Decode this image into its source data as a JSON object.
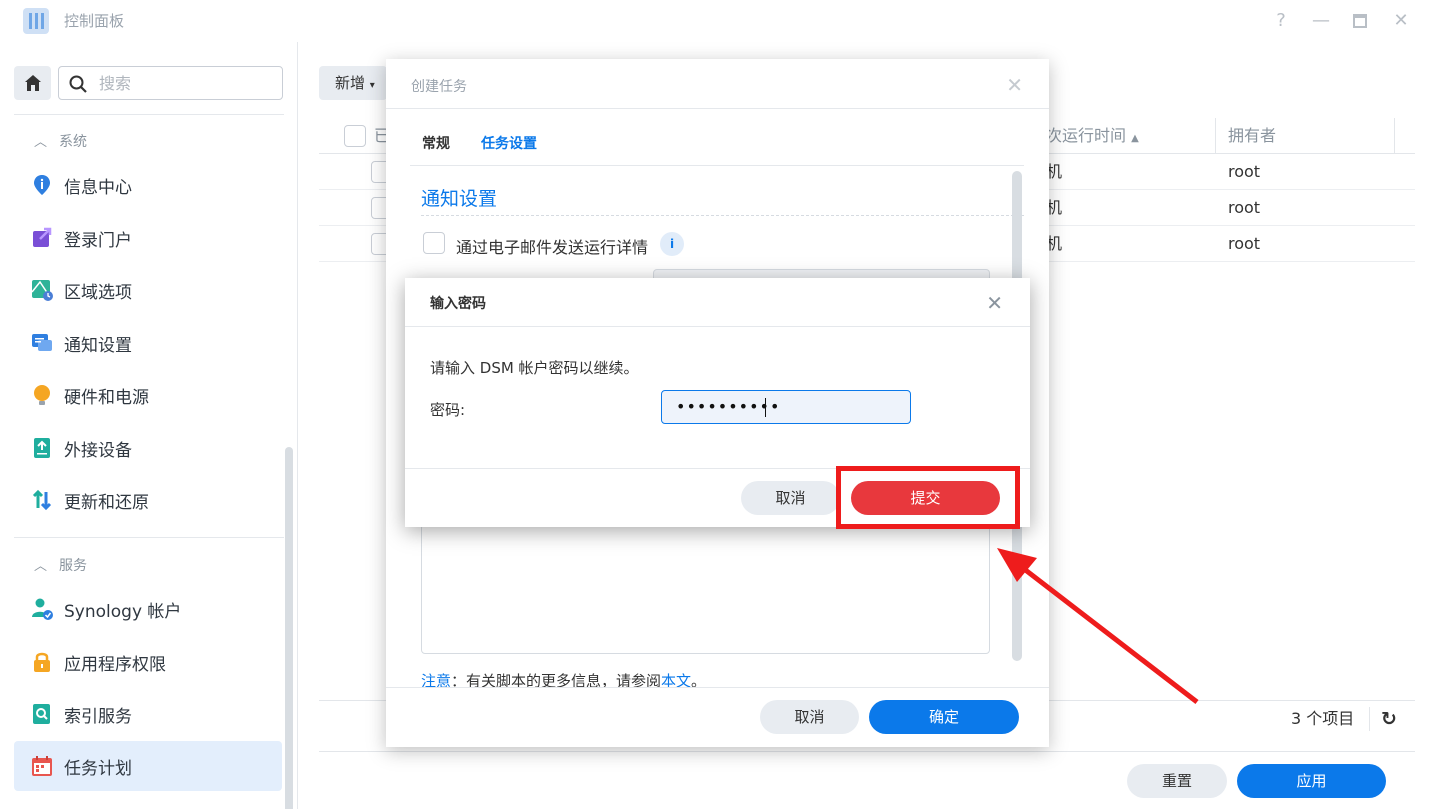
{
  "window": {
    "title": "控制面板"
  },
  "sidebar": {
    "search_placeholder": "搜索",
    "section_system": "系统",
    "section_services": "服务",
    "items": [
      {
        "label": "信息中心",
        "icon": "info-icon"
      },
      {
        "label": "登录门户",
        "icon": "login-portal-icon"
      },
      {
        "label": "区域选项",
        "icon": "region-icon"
      },
      {
        "label": "通知设置",
        "icon": "notification-icon"
      },
      {
        "label": "硬件和电源",
        "icon": "lightbulb-icon"
      },
      {
        "label": "外接设备",
        "icon": "external-device-icon"
      },
      {
        "label": "更新和还原",
        "icon": "update-restore-icon"
      },
      {
        "label": "Synology 帐户",
        "icon": "synology-account-icon"
      },
      {
        "label": "应用程序权限",
        "icon": "lock-icon"
      },
      {
        "label": "索引服务",
        "icon": "index-service-icon"
      },
      {
        "label": "任务计划",
        "icon": "calendar-icon"
      }
    ]
  },
  "main": {
    "add_button": "新增",
    "table": {
      "col_enabled": "已",
      "col_next_run": "次运行时间",
      "col_owner": "拥有者",
      "rows": [
        {
          "next_run": "机",
          "owner": "root"
        },
        {
          "next_run": "机",
          "owner": "root"
        },
        {
          "next_run": "机",
          "owner": "root"
        }
      ]
    },
    "item_count": "3 个项目",
    "reset_button": "重置",
    "apply_button": "应用"
  },
  "create_task_dialog": {
    "title": "创建任务",
    "tabs": [
      "常规",
      "任务设置"
    ],
    "active_tab": 1,
    "section_title": "通知设置",
    "email_checkbox_label": "通过电子邮件发送运行详情",
    "note_prefix": "注意",
    "note_text": "：有关脚本的更多信息，请参阅",
    "note_link": "本文",
    "note_end": "。",
    "cancel_button": "取消",
    "ok_button": "确定"
  },
  "password_dialog": {
    "title": "输入密码",
    "prompt": "请输入 DSM 帐户密码以继续。",
    "password_label": "密码:",
    "password_value": "••••••••••",
    "cancel_button": "取消",
    "submit_button": "提交"
  },
  "colors": {
    "accent": "#0b79ea",
    "submit": "#e8383d",
    "annotation": "#ee1c1c"
  }
}
